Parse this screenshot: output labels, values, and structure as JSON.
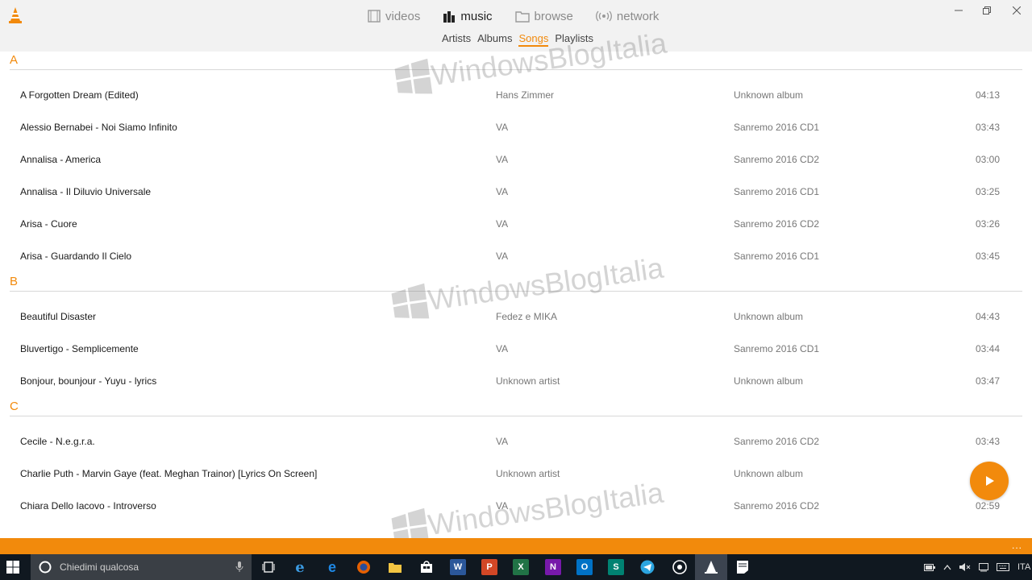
{
  "nav": {
    "main": [
      {
        "label": "videos",
        "icon": "film-icon",
        "active": false
      },
      {
        "label": "music",
        "icon": "music-bars-icon",
        "active": true
      },
      {
        "label": "browse",
        "icon": "folder-icon",
        "active": false
      },
      {
        "label": "network",
        "icon": "broadcast-icon",
        "active": false
      }
    ],
    "sub": [
      {
        "label": "Artists",
        "active": false
      },
      {
        "label": "Albums",
        "active": false
      },
      {
        "label": "Songs",
        "active": true
      },
      {
        "label": "Playlists",
        "active": false
      }
    ]
  },
  "watermark": "WindowsBlogItalia",
  "groups": [
    {
      "letter": "A",
      "songs": [
        {
          "title": "A Forgotten Dream (Edited)",
          "artist": "Hans Zimmer",
          "album": "Unknown album",
          "duration": "04:13"
        },
        {
          "title": "Alessio Bernabei - Noi Siamo Infinito",
          "artist": "VA",
          "album": "Sanremo 2016 CD1",
          "duration": "03:43"
        },
        {
          "title": "Annalisa - America",
          "artist": "VA",
          "album": "Sanremo 2016 CD2",
          "duration": "03:00"
        },
        {
          "title": "Annalisa - Il Diluvio Universale",
          "artist": "VA",
          "album": "Sanremo 2016 CD1",
          "duration": "03:25"
        },
        {
          "title": "Arisa - Cuore",
          "artist": "VA",
          "album": "Sanremo 2016 CD2",
          "duration": "03:26"
        },
        {
          "title": "Arisa - Guardando Il Cielo",
          "artist": "VA",
          "album": "Sanremo 2016 CD1",
          "duration": "03:45"
        }
      ]
    },
    {
      "letter": "B",
      "songs": [
        {
          "title": "Beautiful Disaster",
          "artist": "Fedez e MIKA",
          "album": "Unknown album",
          "duration": "04:43"
        },
        {
          "title": "Bluvertigo - Semplicemente",
          "artist": "VA",
          "album": "Sanremo 2016 CD1",
          "duration": "03:44"
        },
        {
          "title": "Bonjour, bounjour - Yuyu - lyrics",
          "artist": "Unknown artist",
          "album": "Unknown album",
          "duration": "03:47"
        }
      ]
    },
    {
      "letter": "C",
      "songs": [
        {
          "title": "Cecile - N.e.g.r.a.",
          "artist": "VA",
          "album": "Sanremo 2016 CD2",
          "duration": "03:43"
        },
        {
          "title": "Charlie Puth -  Marvin Gaye  (feat. Meghan Trainor) [Lyrics On Screen]",
          "artist": "Unknown artist",
          "album": "Unknown album",
          "duration": ""
        },
        {
          "title": "Chiara Dello Iacovo - Introverso",
          "artist": "VA",
          "album": "Sanremo 2016 CD2",
          "duration": "02:59"
        }
      ]
    }
  ],
  "bottom_bar": {
    "more": "..."
  },
  "taskbar": {
    "search_placeholder": "Chiedimi qualcosa",
    "apps": [
      {
        "icon": "task-view-icon",
        "glyph": ""
      },
      {
        "icon": "internet-explorer-icon",
        "glyph": "e"
      },
      {
        "icon": "edge-icon",
        "glyph": "e"
      },
      {
        "icon": "firefox-icon",
        "glyph": ""
      },
      {
        "icon": "file-explorer-icon",
        "glyph": ""
      },
      {
        "icon": "store-icon",
        "glyph": ""
      },
      {
        "icon": "word-icon",
        "glyph": "W"
      },
      {
        "icon": "powerpoint-icon",
        "glyph": "P"
      },
      {
        "icon": "excel-icon",
        "glyph": "X"
      },
      {
        "icon": "onenote-icon",
        "glyph": "N"
      },
      {
        "icon": "outlook-icon",
        "glyph": "O"
      },
      {
        "icon": "sway-icon",
        "glyph": "S"
      },
      {
        "icon": "telegram-icon",
        "glyph": ""
      },
      {
        "icon": "whatsapp-icon",
        "glyph": ""
      },
      {
        "icon": "vlc-icon",
        "glyph": ""
      },
      {
        "icon": "notepad-icon",
        "glyph": ""
      }
    ],
    "language": "ITA"
  },
  "colors": {
    "accent": "#f28a0c",
    "taskbar": "#101820"
  }
}
